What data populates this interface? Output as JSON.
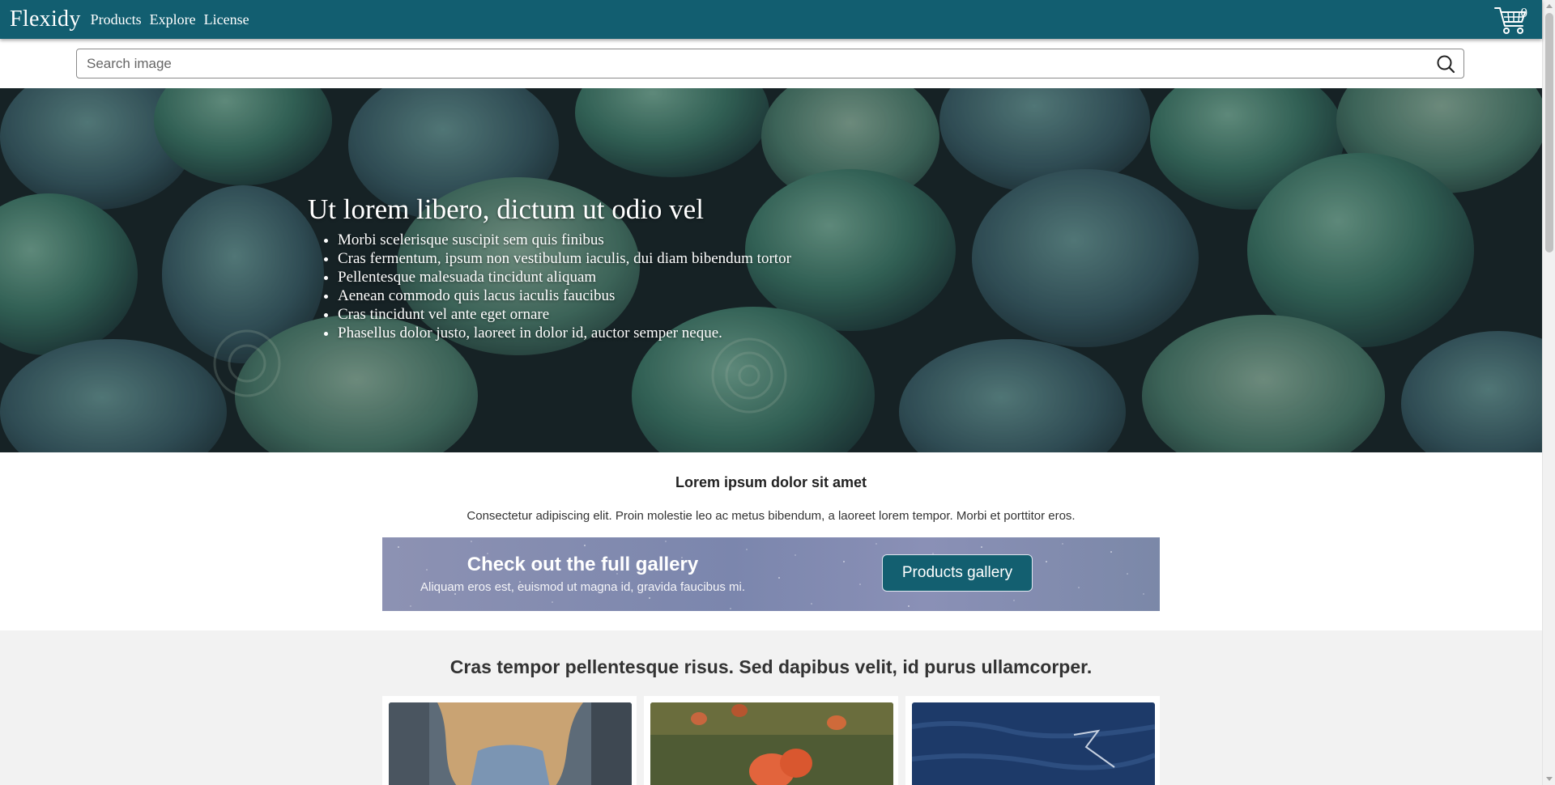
{
  "nav": {
    "brand": "Flexidy",
    "links": [
      "Products",
      "Explore",
      "License"
    ],
    "cart_count": "0"
  },
  "search": {
    "placeholder": "Search image",
    "value": ""
  },
  "hero": {
    "title": "Ut lorem libero, dictum ut odio vel",
    "items": [
      "Morbi scelerisque suscipit sem quis finibus",
      "Cras fermentum, ipsum non vestibulum iaculis, dui diam bibendum tortor",
      "Pellentesque malesuada tincidunt aliquam",
      "Aenean commodo quis lacus iaculis faucibus",
      "Cras tincidunt vel ante eget ornare",
      "Phasellus dolor justo, laoreet in dolor id, auctor semper neque."
    ]
  },
  "intro": {
    "title": "Lorem ipsum dolor sit amet",
    "text": "Consectetur adipiscing elit. Proin molestie leo ac metus bibendum, a laoreet lorem tempor. Morbi et porttitor eros."
  },
  "promo": {
    "title": "Check out the full gallery",
    "subtitle": "Aliquam eros est, euismod ut magna id, gravida faucibus mi.",
    "button": "Products gallery"
  },
  "gallery": {
    "title": "Cras tempor pellentesque risus. Sed dapibus velit, id purus ullamcorper."
  },
  "colors": {
    "primary": "#125e70",
    "page_bg": "#f2f2f2"
  }
}
